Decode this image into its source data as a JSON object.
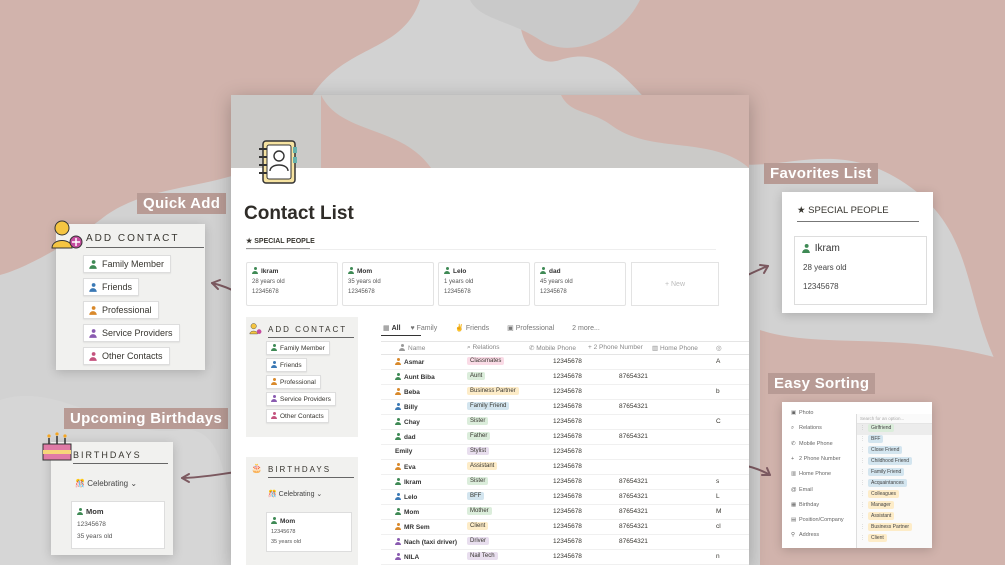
{
  "callouts": {
    "quick_add": "Quick Add",
    "favorites": "Favorites List",
    "upcoming_birthdays": "Upcoming Birthdays",
    "easy_sorting": "Easy Sorting"
  },
  "quick_add_card": {
    "header": "ADD CONTACT",
    "buttons": [
      "Family Member",
      "Friends",
      "Professional",
      "Service Providers",
      "Other Contacts"
    ],
    "button_colors": [
      "#3f8a55",
      "#3b79b5",
      "#d9892b",
      "#8a5bb0",
      "#c4537e"
    ]
  },
  "birthdays_card": {
    "header": "BIRTHDAYS",
    "view": "Celebrating",
    "card_name": "Mom",
    "card_phone": "12345678",
    "card_age": "35 years old"
  },
  "favorites_card": {
    "header": "SPECIAL PEOPLE",
    "name": "Ikram",
    "age": "28 years old",
    "phone": "12345678"
  },
  "sorting_card": {
    "properties": [
      "Photo",
      "Relations",
      "Mobile Phone",
      "2 Phone Number",
      "Home Phone",
      "Email",
      "Birthday",
      "Position/Company",
      "Address"
    ],
    "search_placeholder": "Search for an option...",
    "options": [
      "Girlfriend",
      "BFF",
      "Close Friend",
      "Childhood Friend",
      "Family Friend",
      "Acquaintances",
      "Colleagues",
      "Manager",
      "Assistant",
      "Business Partner",
      "Client"
    ],
    "option_colors": [
      "#dbeddb",
      "#d3e5ef",
      "#d3e5ef",
      "#d3e5ef",
      "#d3e5ef",
      "#d3e5ef",
      "#fdecc8",
      "#fdecc8",
      "#fdecc8",
      "#fdecc8",
      "#fdecc8"
    ]
  },
  "page": {
    "title": "Contact List",
    "special_header": "SPECIAL PEOPLE",
    "special_cards": [
      {
        "name": "Ikram",
        "age": "28 years old",
        "phone": "12345678"
      },
      {
        "name": "Mom",
        "age": "35 years old",
        "phone": "12345678"
      },
      {
        "name": "Lelo",
        "age": "1 years old",
        "phone": "12345678"
      },
      {
        "name": "dad",
        "age": "45 years old",
        "phone": "12345678"
      }
    ],
    "new_label": "+ New",
    "add_header": "ADD CONTACT",
    "add_buttons": [
      "Family Member",
      "Friends",
      "Professional",
      "Service Providers",
      "Other Contacts"
    ],
    "birthdays_header": "BIRTHDAYS",
    "birthdays_view": "Celebrating",
    "birthday_card": {
      "name": "Mom",
      "phone": "12345678",
      "age": "35 years old"
    },
    "tabs": [
      "All",
      "Family",
      "Friends",
      "Professional",
      "2 more..."
    ],
    "columns": [
      "Name",
      "Relations",
      "Mobile Phone",
      "2 Phone Number",
      "Home Phone"
    ],
    "rows": [
      {
        "name": "Asmar",
        "rel": "Classmates",
        "color": "#fadbe6",
        "mobile": "12345678",
        "phone2": "",
        "extra": "A"
      },
      {
        "name": "Aunt Biba",
        "rel": "Aunt",
        "color": "#dbeddb",
        "mobile": "12345678",
        "phone2": "87654321",
        "extra": ""
      },
      {
        "name": "Beba",
        "rel": "Business Partner",
        "color": "#fdecc8",
        "mobile": "12345678",
        "phone2": "",
        "extra": "b"
      },
      {
        "name": "Billy",
        "rel": "Family Friend",
        "color": "#d3e5ef",
        "mobile": "12345678",
        "phone2": "87654321",
        "extra": ""
      },
      {
        "name": "Chay",
        "rel": "Sister",
        "color": "#dbeddb",
        "mobile": "12345678",
        "phone2": "",
        "extra": "C"
      },
      {
        "name": "dad",
        "rel": "Father",
        "color": "#dbeddb",
        "mobile": "12345678",
        "phone2": "87654321",
        "extra": ""
      },
      {
        "name": "Emily",
        "rel": "Stylist",
        "color": "#e8deee",
        "mobile": "12345678",
        "phone2": "",
        "extra": ""
      },
      {
        "name": "Eva",
        "rel": "Assistant",
        "color": "#fdecc8",
        "mobile": "12345678",
        "phone2": "",
        "extra": ""
      },
      {
        "name": "Ikram",
        "rel": "Sister",
        "color": "#dbeddb",
        "mobile": "12345678",
        "phone2": "87654321",
        "extra": "s"
      },
      {
        "name": "Lelo",
        "rel": "BFF",
        "color": "#d3e5ef",
        "mobile": "12345678",
        "phone2": "87654321",
        "extra": "L"
      },
      {
        "name": "Mom",
        "rel": "Mother",
        "color": "#dbeddb",
        "mobile": "12345678",
        "phone2": "87654321",
        "extra": "M"
      },
      {
        "name": "MR Sem",
        "rel": "Client",
        "color": "#fdecc8",
        "mobile": "12345678",
        "phone2": "87654321",
        "extra": "cl"
      },
      {
        "name": "Nach (taxi driver)",
        "rel": "Driver",
        "color": "#e8deee",
        "mobile": "12345678",
        "phone2": "87654321",
        "extra": ""
      },
      {
        "name": "NILA",
        "rel": "Nail Tech",
        "color": "#e8deee",
        "mobile": "12345678",
        "phone2": "",
        "extra": "n"
      }
    ],
    "row_icon_colors": [
      "#d9892b",
      "#3f8a55",
      "#d9892b",
      "#3b79b5",
      "#3f8a55",
      "#3f8a55",
      "",
      "#d9892b",
      "#3f8a55",
      "#3b79b5",
      "#3f8a55",
      "#d9892b",
      "#8a5bb0",
      "#8a5bb0"
    ]
  }
}
